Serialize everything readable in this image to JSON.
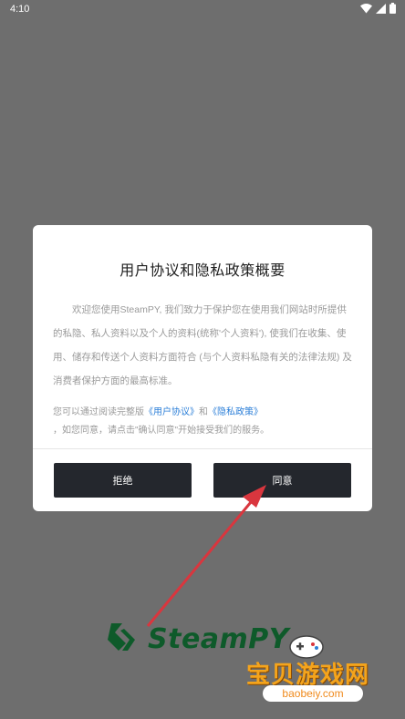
{
  "status_bar": {
    "time": "4:10"
  },
  "dialog": {
    "title": "用户协议和隐私政策概要",
    "body": "欢迎您使用SteamPY, 我们致力于保护您在使用我们网站时所提供的私隐、私人资料以及个人的资料(统称'个人资料'), 使我们在收集、使用、储存和传送个人资料方面符合 (与个人资料私隐有关的法律法规) 及消费者保护方面的最高标准。",
    "links_prefix": "您可以通过阅读完整版",
    "user_agreement_link": "《用户协议》",
    "links_and": "和",
    "privacy_policy_link": "《隐私政策》",
    "links_suffix": "，如您同意，请点击\"确认同意\"开始接受我们的服务。",
    "decline_label": "拒绝",
    "agree_label": "同意"
  },
  "watermark": {
    "logo_text": "SteamPY",
    "site_name": "宝贝游戏网",
    "site_url": "baobeiy.com"
  },
  "colors": {
    "overlay": "#6e6e6e",
    "button": "#24272d",
    "link": "#2c7fd8",
    "arrow": "#d9363e"
  }
}
